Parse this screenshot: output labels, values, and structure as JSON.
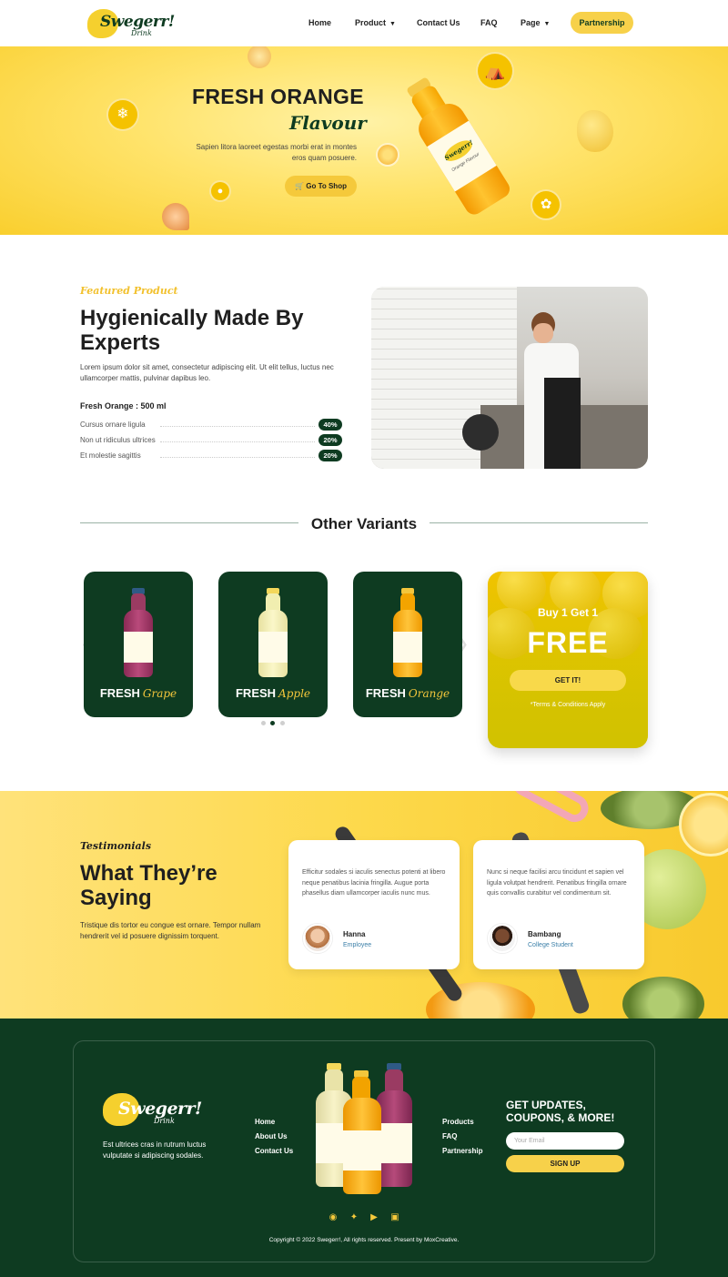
{
  "brand": {
    "name": "Swegerr!",
    "sub": "Drink"
  },
  "nav": {
    "items": [
      {
        "label": "Home"
      },
      {
        "label": "Product"
      },
      {
        "label": "Contact Us"
      },
      {
        "label": "FAQ"
      },
      {
        "label": "Page"
      }
    ],
    "cta": "Partnership"
  },
  "hero": {
    "title": "FRESH ORANGE",
    "flavour": "Flavour",
    "subtitle": "Sapien litora laoreet egestas morbi erat in montes eros quam posuere.",
    "button": "Go To Shop",
    "bottle_brand": "Swegerr!",
    "bottle_variant": "Orange Flavour"
  },
  "featured": {
    "tag": "Featured Product",
    "title": "Hygienically Made By Experts",
    "description": "Lorem ipsum dolor sit amet, consectetur adipiscing elit. Ut elit tellus, luctus nec ullamcorper mattis, pulvinar dapibus leo.",
    "size_label": "Fresh Orange : 500 ml",
    "stats": [
      {
        "label": "Cursus ornare ligula",
        "value": "40%"
      },
      {
        "label": "Non ut ridiculus ultrices",
        "value": "20%"
      },
      {
        "label": "Et molestie sagittis",
        "value": "20%"
      }
    ]
  },
  "variants": {
    "title": "Other Variants",
    "cards": [
      {
        "word": "FRESH",
        "flavor": "Grape"
      },
      {
        "word": "FRESH",
        "flavor": "Apple"
      },
      {
        "word": "FRESH",
        "flavor": "Orange"
      }
    ],
    "promo": {
      "line1": "Buy 1 Get 1",
      "line2": "FREE",
      "button": "GET IT!",
      "terms": "*Terms & Conditions Apply"
    }
  },
  "testimonials": {
    "tag": "Testimonials",
    "title": "What They’re Saying",
    "description": "Tristique dis tortor eu congue est ornare. Tempor nullam hendrerit vel id posuere dignissim torquent.",
    "items": [
      {
        "quote": "Efficitur sodales si iaculis senectus potenti at libero neque penatibus lacinia fringilla. Augue porta phasellus diam ullamcorper iaculis nunc mus.",
        "name": "Hanna",
        "role": "Employee"
      },
      {
        "quote": "Nunc si neque facilisi arcu tincidunt et sapien vel ligula volutpat hendrerit. Penatibus fringilla ornare quis convallis curabitur vel condimentum sit.",
        "name": "Bambang",
        "role": "College Student"
      }
    ]
  },
  "footer": {
    "description": "Est ultrices cras in rutrum luctus vulputate si adipiscing sodales.",
    "links_left": [
      "Home",
      "About Us",
      "Contact Us"
    ],
    "links_right": [
      "Products",
      "FAQ",
      "Partnership"
    ],
    "newsletter_title": "GET UPDATES, COUPONS, & MORE!",
    "email_placeholder": "Your Email",
    "signup": "SIGN UP",
    "copyright": "Copyright © 2022 Swegerr!, All rights reserved. Present by MoxCreative."
  },
  "colors": {
    "dark_green": "#0e3b21",
    "yellow": "#f7d14a",
    "hero_yellow": "#ffe36a"
  },
  "icons": [
    "chevron-down-icon",
    "cart-icon",
    "wheat-icon",
    "basket-icon",
    "leaf-icon",
    "apple-icon",
    "arrow-left-icon",
    "arrow-right-icon",
    "facebook-icon",
    "twitter-icon",
    "youtube-icon",
    "instagram-icon"
  ]
}
